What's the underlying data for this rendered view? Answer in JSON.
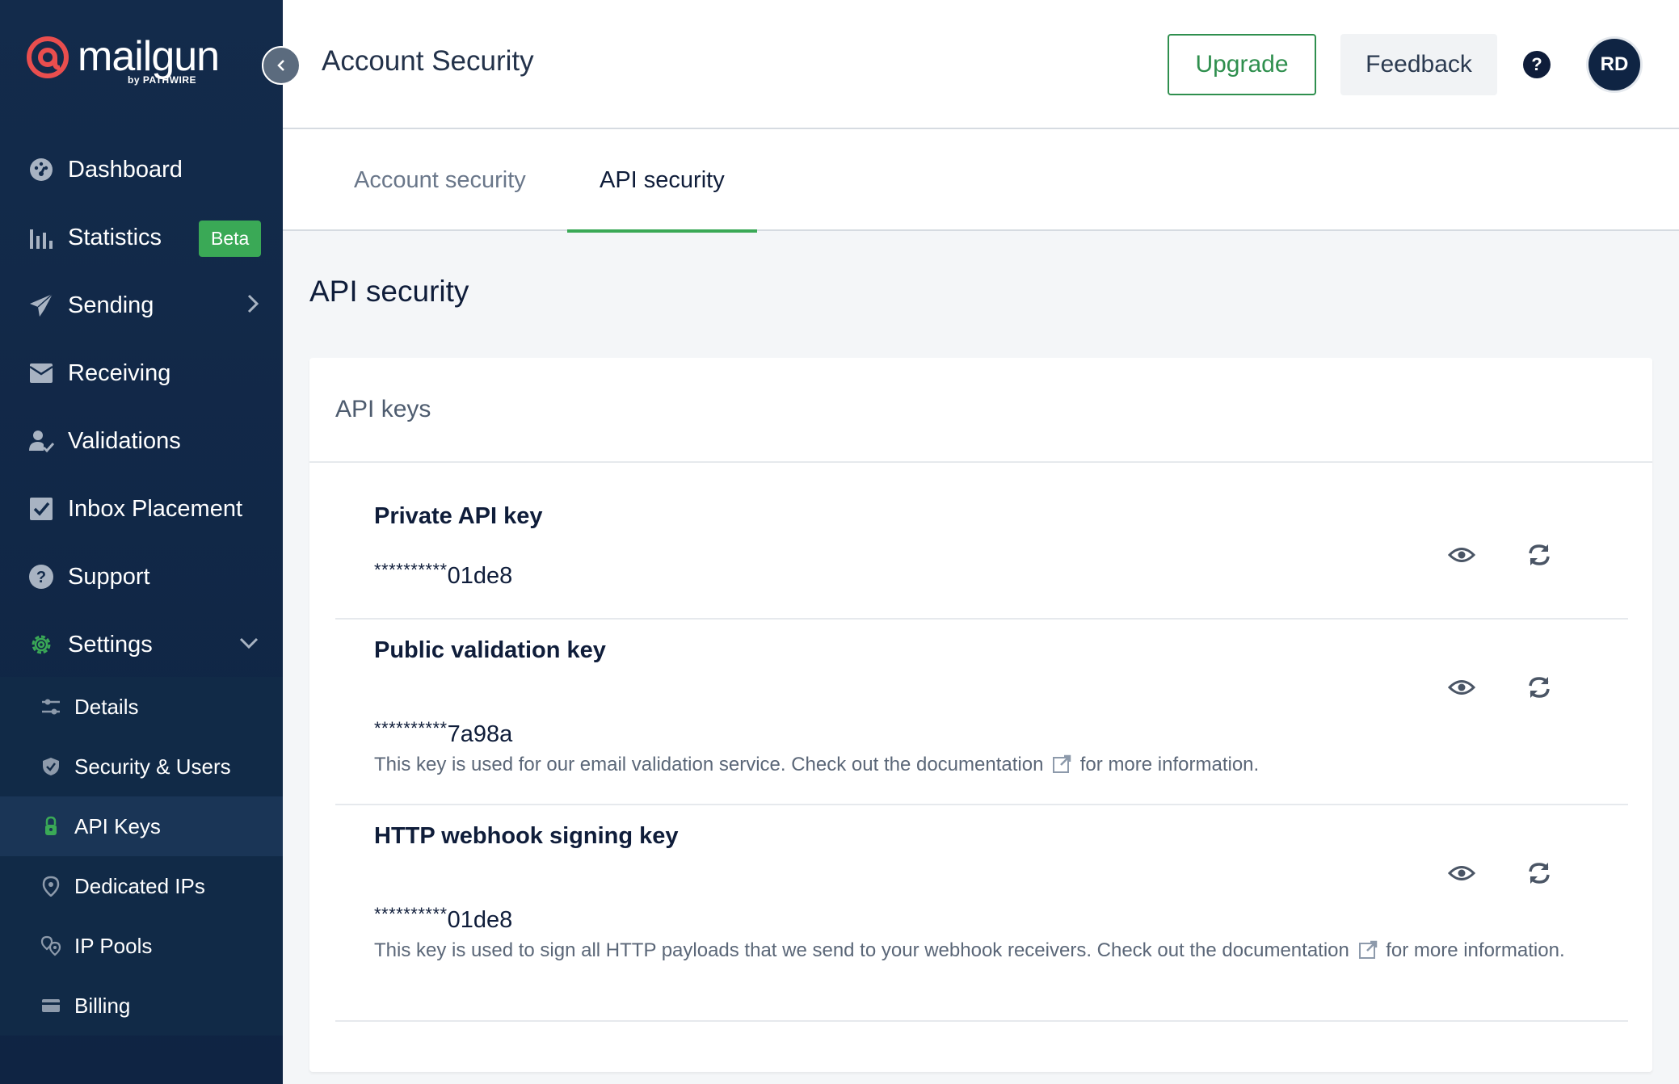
{
  "brand": {
    "name": "mailgun",
    "byline": "by PATHWIRE",
    "accent": "#e94e4e"
  },
  "sidebar": {
    "items": [
      {
        "label": "Dashboard",
        "icon": "dashboard-icon"
      },
      {
        "label": "Statistics",
        "icon": "bar-chart-icon",
        "badge": "Beta"
      },
      {
        "label": "Sending",
        "icon": "paper-plane-icon"
      },
      {
        "label": "Receiving",
        "icon": "inbox-icon"
      },
      {
        "label": "Validations",
        "icon": "user-check-icon"
      },
      {
        "label": "Inbox Placement",
        "icon": "checkbox-icon"
      },
      {
        "label": "Support",
        "icon": "help-circle-icon"
      },
      {
        "label": "Settings",
        "icon": "gear-icon"
      }
    ],
    "subitems": [
      {
        "label": "Details",
        "icon": "sliders-icon"
      },
      {
        "label": "Security & Users",
        "icon": "shield-icon"
      },
      {
        "label": "API Keys",
        "icon": "lock-icon",
        "active": true
      },
      {
        "label": "Dedicated IPs",
        "icon": "location-pin-icon"
      },
      {
        "label": "IP Pools",
        "icon": "pins-icon"
      },
      {
        "label": "Billing",
        "icon": "credit-card-icon"
      }
    ]
  },
  "header": {
    "title": "Account Security",
    "upgrade_label": "Upgrade",
    "feedback_label": "Feedback",
    "help_label": "?",
    "avatar_initials": "RD"
  },
  "tabs": [
    {
      "label": "Account security",
      "active": false
    },
    {
      "label": "API security",
      "active": true
    }
  ],
  "main": {
    "section_title": "API security",
    "card_title": "API keys",
    "keys": [
      {
        "name": "Private API key",
        "masked": "**********",
        "suffix": "01de8",
        "description": null
      },
      {
        "name": "Public validation key",
        "masked": "**********",
        "suffix": "7a98a",
        "description_before": "This key is used for our email validation service. Check out the documentation",
        "description_after": "for more information."
      },
      {
        "name": "HTTP webhook signing key",
        "masked": "**********",
        "suffix": "01de8",
        "description_before": "This key is used to sign all HTTP payloads that we send to your webhook receivers. Check out the documentation",
        "description_after": "for more information."
      }
    ]
  },
  "colors": {
    "sidebar": "#132b4b",
    "green": "#3aa956",
    "upgrade": "#2f8f4e"
  }
}
